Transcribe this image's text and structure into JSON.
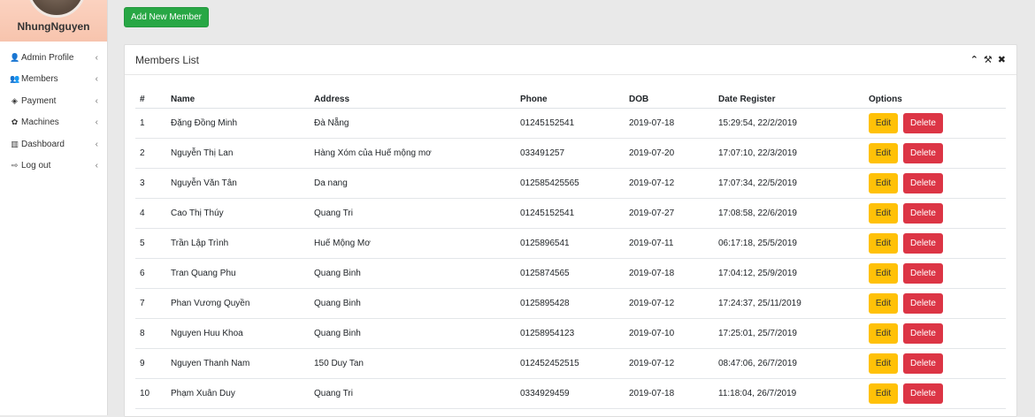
{
  "profile": {
    "name": "NhungNguyen"
  },
  "sidebar": {
    "items": [
      {
        "label": "Admin Profile",
        "icon": "user-icon",
        "glyph": "👤"
      },
      {
        "label": "Members",
        "icon": "users-icon",
        "glyph": "👥"
      },
      {
        "label": "Payment",
        "icon": "tag-icon",
        "glyph": "◈"
      },
      {
        "label": "Machines",
        "icon": "gear-icon",
        "glyph": "✿"
      },
      {
        "label": "Dashboard",
        "icon": "bar-chart-icon",
        "glyph": "▥"
      },
      {
        "label": "Log out",
        "icon": "sign-out-icon",
        "glyph": "⇨"
      }
    ],
    "chevron": "‹"
  },
  "toolbar": {
    "add_label": "Add New Member"
  },
  "panel": {
    "title": "Members List",
    "tools": {
      "collapse": "⌃",
      "settings": "⚒",
      "close": "✖"
    }
  },
  "table": {
    "headers": [
      "#",
      "Name",
      "Address",
      "Phone",
      "DOB",
      "Date Register",
      "Options"
    ],
    "edit_label": "Edit",
    "delete_label": "Delete",
    "rows": [
      [
        "1",
        "Đặng Đồng Minh",
        "Đà Nẵng",
        "01245152541",
        "2019-07-18",
        "15:29:54, 22/2/2019"
      ],
      [
        "2",
        "Nguyễn Thị Lan",
        "Hàng Xóm của Huế mộng mơ",
        "033491257",
        "2019-07-20",
        "17:07:10, 22/3/2019"
      ],
      [
        "3",
        "Nguyễn Văn Tân",
        "Da nang",
        "012585425565",
        "2019-07-12",
        "17:07:34, 22/5/2019"
      ],
      [
        "4",
        "Cao Thị Thúy",
        "Quang Tri",
        "01245152541",
        "2019-07-27",
        "17:08:58, 22/6/2019"
      ],
      [
        "5",
        "Trần Lập Trình",
        "Huế Mộng Mơ",
        "0125896541",
        "2019-07-11",
        "06:17:18, 25/5/2019"
      ],
      [
        "6",
        "Tran Quang Phu",
        "Quang Binh",
        "0125874565",
        "2019-07-18",
        "17:04:12, 25/9/2019"
      ],
      [
        "7",
        "Phan Vương Quyền",
        "Quang Binh",
        "0125895428",
        "2019-07-12",
        "17:24:37, 25/11/2019"
      ],
      [
        "8",
        "Nguyen Huu Khoa",
        "Quang Binh",
        "01258954123",
        "2019-07-10",
        "17:25:01, 25/7/2019"
      ],
      [
        "9",
        "Nguyen Thanh Nam",
        "150 Duy Tan",
        "012452452515",
        "2019-07-12",
        "08:47:06, 26/7/2019"
      ],
      [
        "10",
        "Phạm Xuân Duy",
        "Quang Tri",
        "0334929459",
        "2019-07-18",
        "11:18:04, 26/7/2019"
      ]
    ]
  }
}
